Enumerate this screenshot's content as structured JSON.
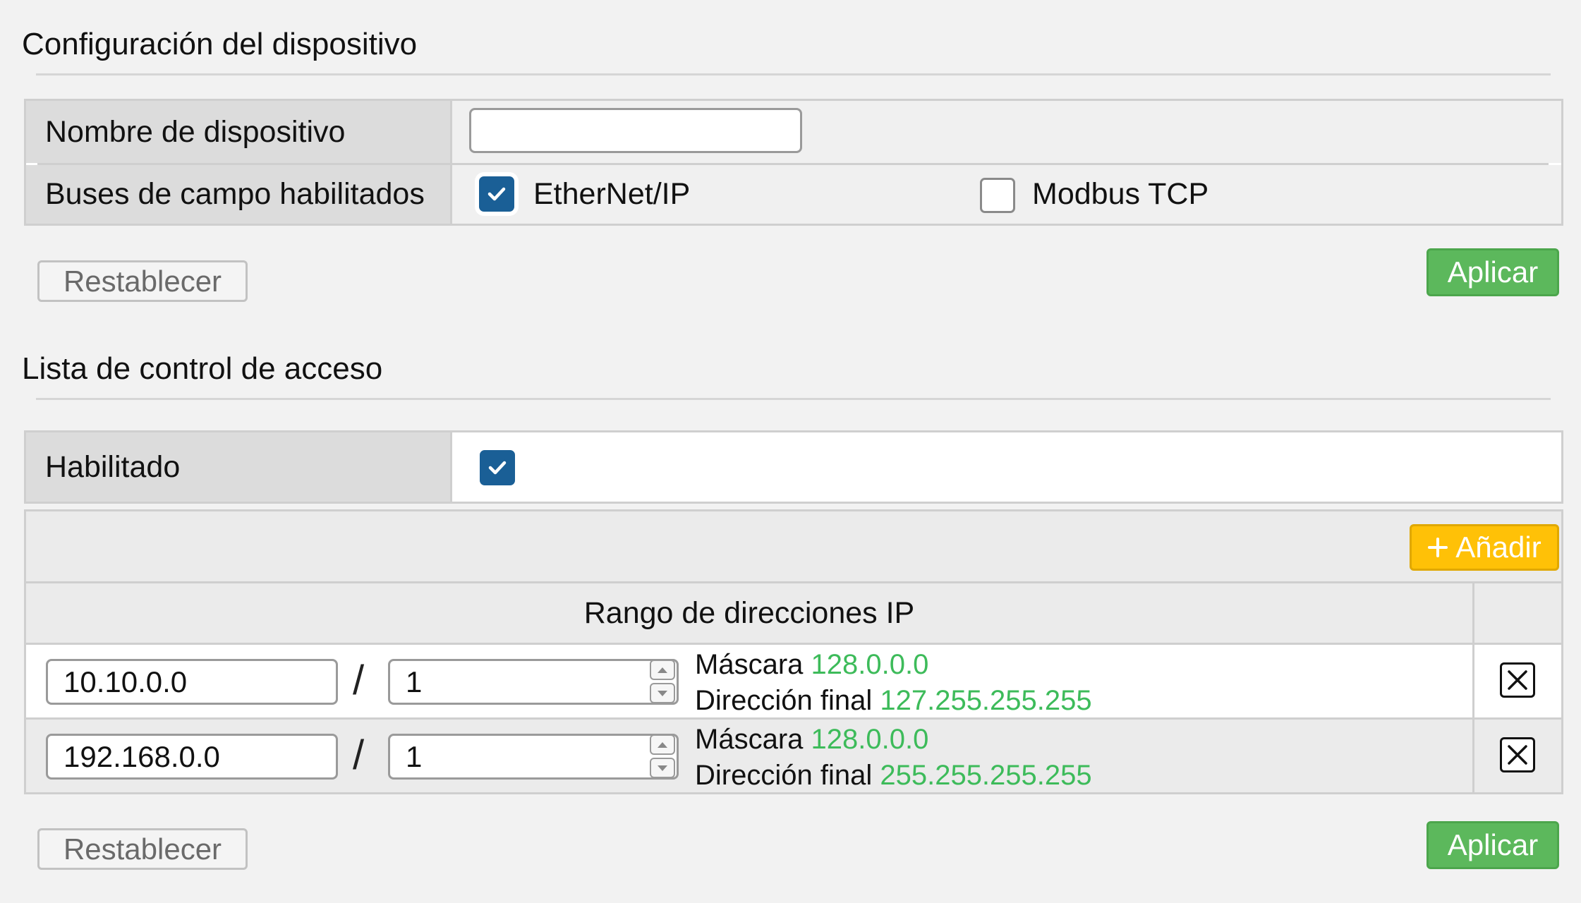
{
  "device_config": {
    "title": "Configuración del dispositivo",
    "name_label": "Nombre de dispositivo",
    "name_value": "",
    "fieldbus_label": "Buses de campo habilitados",
    "fieldbuses": [
      {
        "label": "EtherNet/IP",
        "checked": true
      },
      {
        "label": "Modbus TCP",
        "checked": false
      }
    ],
    "reset_label": "Restablecer",
    "apply_label": "Aplicar"
  },
  "acl": {
    "title": "Lista de control de acceso",
    "enabled_label": "Habilitado",
    "enabled": true,
    "add_label": "Añadir",
    "column_header": "Rango de direcciones IP",
    "mask_label": "Máscara",
    "end_label": "Dirección final",
    "rows": [
      {
        "ip": "10.10.0.0",
        "prefix": "1",
        "mask": "128.0.0.0",
        "end": "127.255.255.255"
      },
      {
        "ip": "192.168.0.0",
        "prefix": "1",
        "mask": "128.0.0.0",
        "end": "255.255.255.255"
      }
    ],
    "reset_label": "Restablecer",
    "apply_label": "Aplicar"
  },
  "icons": [
    "check-icon",
    "plus-icon",
    "close-icon",
    "chevron-up-icon",
    "chevron-down-icon"
  ],
  "colors": {
    "apply": "#5cb85c",
    "add": "#ffc107",
    "checkbox": "#1a5f96",
    "value_green": "#3dbb5a"
  }
}
